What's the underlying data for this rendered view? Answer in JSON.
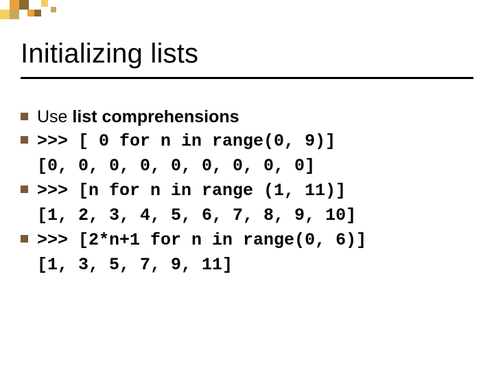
{
  "colors": {
    "bullet": "#7a5a3a",
    "deco_orange": "#e8a23a",
    "deco_yellow": "#f2cf63",
    "deco_brown": "#8a6a2e",
    "deco_tan": "#c9a75a"
  },
  "title": "Initializing lists",
  "lines": [
    {
      "bullet": true,
      "prefix": "Use ",
      "bold": "list comprehensions",
      "code": ""
    },
    {
      "bullet": true,
      "code": ">>> [ 0 for n in range(0, 9)]"
    },
    {
      "bullet": false,
      "code": "[0, 0, 0, 0, 0, 0, 0, 0, 0]"
    },
    {
      "bullet": true,
      "code": ">>> [n for n in range (1, 11)]"
    },
    {
      "bullet": false,
      "code": "[1, 2, 3, 4, 5, 6, 7, 8, 9, 10]"
    },
    {
      "bullet": true,
      "code": ">>> [2*n+1 for n in range(0, 6)]"
    },
    {
      "bullet": false,
      "code": "[1, 3, 5, 7, 9, 11]"
    }
  ]
}
